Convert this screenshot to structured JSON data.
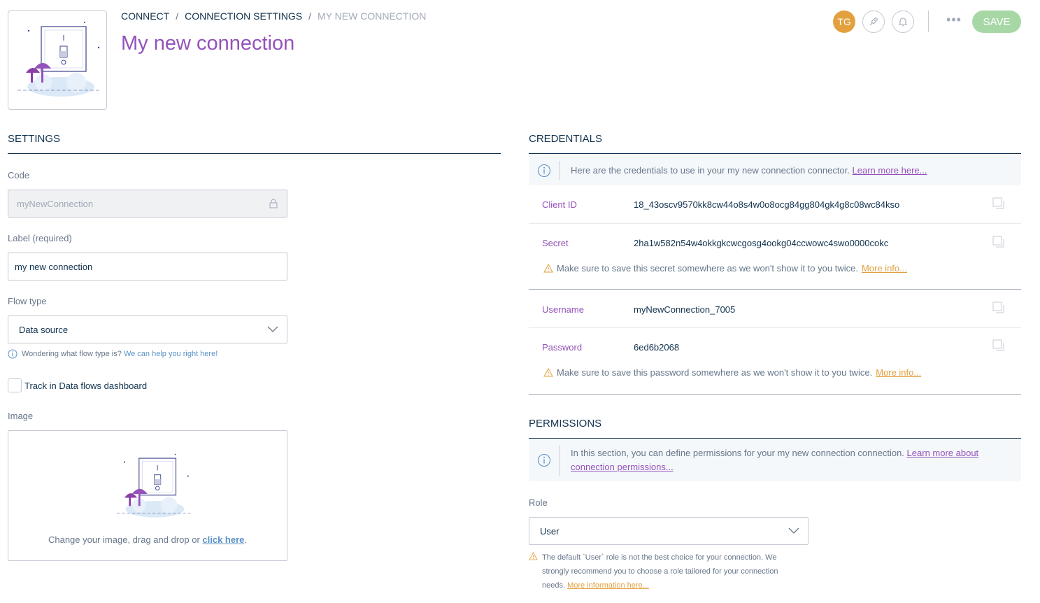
{
  "header": {
    "breadcrumb": {
      "items": [
        "Connect",
        "Connection settings",
        "My new connection"
      ],
      "separator": "/"
    },
    "title": "My new connection",
    "avatar_initials": "TG",
    "icons": [
      "illustration-connection",
      "rocket-icon",
      "bell-icon",
      "more-icon"
    ],
    "more_label": "•••",
    "save_label": "Save"
  },
  "settings": {
    "title": "Settings",
    "code": {
      "label": "Code",
      "value": "myNewConnection"
    },
    "label": {
      "label": "Label (required)",
      "value": "my new connection"
    },
    "flow_type": {
      "label": "Flow type",
      "value": "Data source",
      "helper_text": "Wondering what flow type is?",
      "helper_link": "We can help you right here!"
    },
    "track": {
      "label": "Track in Data flows dashboard",
      "checked": false
    },
    "image": {
      "label": "Image",
      "caption_prefix": "Change your image, drag and drop or",
      "caption_link": "click here",
      "caption_suffix": "."
    }
  },
  "credentials": {
    "title": "Credentials",
    "info_text": "Here are the credentials to use in your my new connection connector.",
    "info_link": "Learn more here...",
    "client_id": {
      "label": "Client ID",
      "value": "18_43oscv9570kk8cw44o8s4w0o8ocg84gg804gk4g8c08wc84kso"
    },
    "secret": {
      "label": "Secret",
      "value": "2ha1w582n54w4okkgkcwcgosg4ookg04ccwowc4swo0000cokc",
      "warning": "Make sure to save this secret somewhere as we won't show it to you twice.",
      "warning_link": "More info..."
    },
    "username": {
      "label": "Username",
      "value": "myNewConnection_7005"
    },
    "password": {
      "label": "Password",
      "value": "6ed6b2068",
      "warning": "Make sure to save this password somewhere as we won't show it to you twice.",
      "warning_link": "More info..."
    }
  },
  "permissions": {
    "title": "Permissions",
    "info_text": "In this section, you can define permissions for your my new connection connection.",
    "info_link_line1": "Learn more about",
    "info_link_line2": "connection permissions...",
    "role": {
      "label": "Role",
      "value": "User",
      "help_text": "The default `User` role is not the best choice for your connection. We strongly recommend you to choose a role tailored for your connection needs.",
      "help_link": "More information here..."
    }
  },
  "colors": {
    "accent_purple": "#9452ba",
    "text_dark": "#11324d",
    "text_muted": "#67768a",
    "border": "#c7cbd4",
    "save_green": "#a8d7a6",
    "avatar_orange": "#e2a03f",
    "warning_orange": "#e2a03f",
    "link_blue": "#5992c7",
    "info_bg": "#f5f8fb"
  }
}
